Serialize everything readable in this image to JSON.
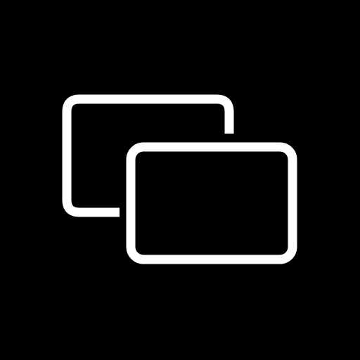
{
  "icon": {
    "name": "overlapping-windows-icon",
    "stroke_color": "#ffffff",
    "background_color": "#000000"
  }
}
